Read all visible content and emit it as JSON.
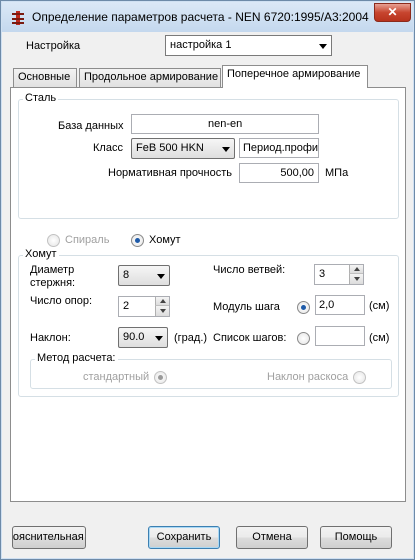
{
  "window": {
    "title": "Определение параметров расчета - NEN 6720:1995/A3:2004",
    "close_label": "✕"
  },
  "setting": {
    "label": "Настройка",
    "value": "настройка 1"
  },
  "tabs": [
    {
      "label": "Основные"
    },
    {
      "label": "Продольное армирование"
    },
    {
      "label": "Поперечное армирование"
    }
  ],
  "steel": {
    "group_title": "Сталь",
    "database_label": "База данных",
    "database_value": "nen-en",
    "class_label": "Класс",
    "class_value": "FeB 500 HKN",
    "profile_value": "Период.профиль",
    "strength_label": "Нормативная прочность",
    "strength_value": "500,00",
    "strength_unit": "МПа"
  },
  "type_choice": {
    "spiral_label": "Спираль",
    "stirrup_label": "Хомут",
    "selected": "stirrup"
  },
  "stirrup": {
    "group_title": "Хомут",
    "diameter_label_1": "Диаметр",
    "diameter_label_2": "стержня:",
    "diameter_value": "8",
    "branches_label": "Число ветвей:",
    "branches_value": "3",
    "supports_label": "Число опор:",
    "supports_value": "2",
    "spacing_module_label": "Модуль шага",
    "spacing_module_value": "2,0",
    "spacing_module_unit": "(см)",
    "incline_label": "Наклон:",
    "incline_value": "90.0",
    "incline_unit": "(град.)",
    "spacing_list_label": "Список шагов:",
    "spacing_list_value": "",
    "spacing_list_unit": "(см)",
    "method_title": "Метод расчета:",
    "method_standard_label": "стандартный",
    "method_strut_label": "Наклон раскоса"
  },
  "buttons": {
    "notes": "Пояснительная записка",
    "save": "Сохранить",
    "cancel": "Отмена",
    "help": "Помощь"
  },
  "colors": {
    "accent": "#1e5aa8",
    "disabled_text": "#a0a0a0",
    "app_icon": "#c0281c"
  }
}
